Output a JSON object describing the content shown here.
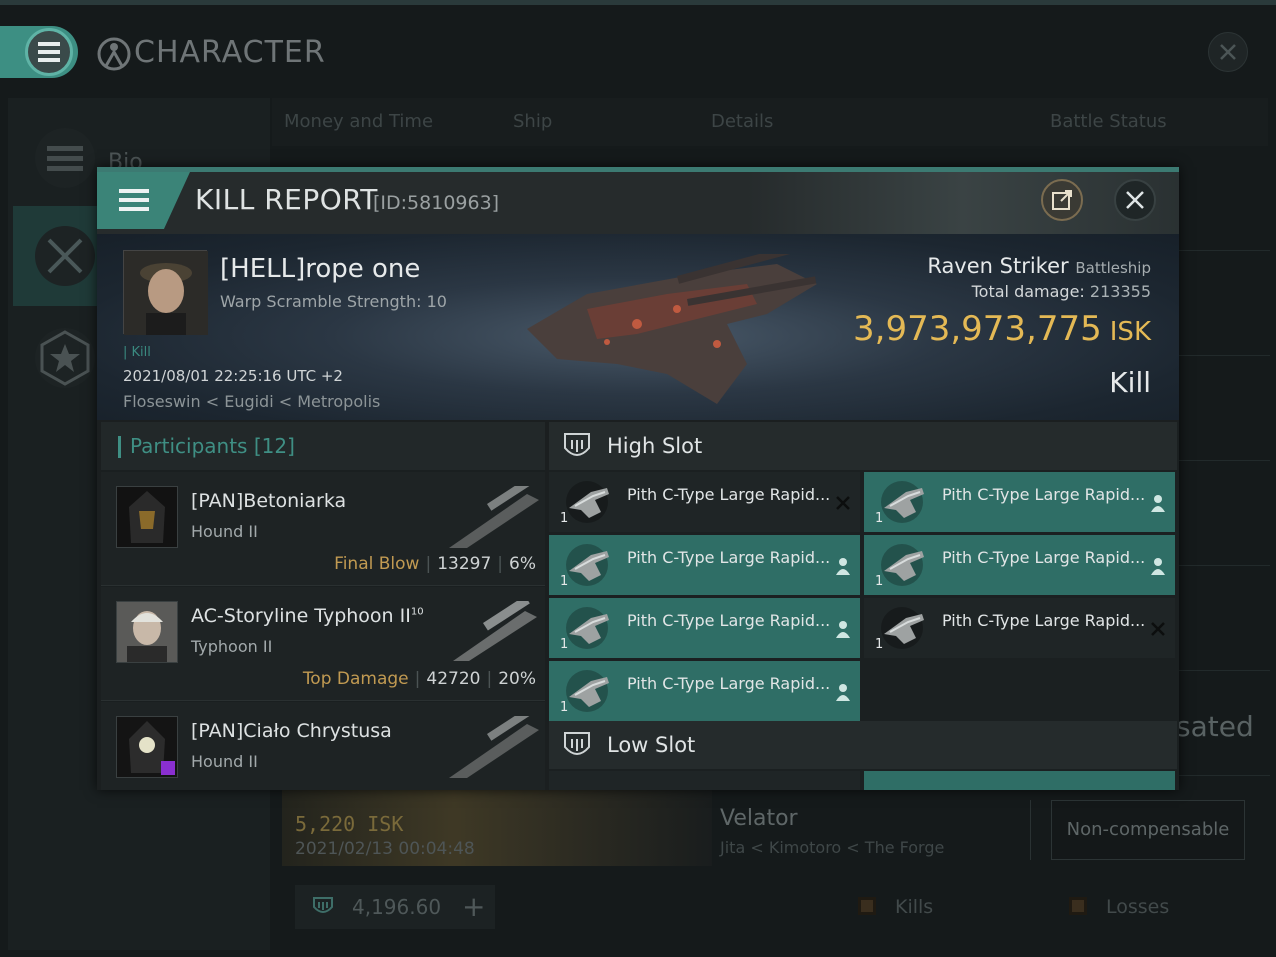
{
  "background_window": {
    "title": "CHARACTER",
    "sidebar": {
      "bio_label": "Bio"
    },
    "tabs": [
      "Money and Time",
      "Ship",
      "Details",
      "Battle Status"
    ],
    "partial_text": "sated",
    "row": {
      "isk": "5,220  ISK",
      "date": "2021/02/13  00:04:48",
      "ship": "Velator",
      "location": "Jita < Kimotoro < The Forge",
      "compensation": "Non-compensable"
    },
    "wallet": {
      "value": "4,196.60",
      "plus": "+"
    },
    "filters": {
      "kills": "Kills",
      "losses": "Losses"
    }
  },
  "kill_report": {
    "title": "KILL REPORT",
    "id": "[ID:5810963]",
    "victim": {
      "name": "[HELL]rope one",
      "warp_scramble": "Warp Scramble Strength: 10",
      "kill_tag": "Kill",
      "datetime": "2021/08/01 22:25:16 UTC +2",
      "location": "Floseswin < Eugidi < Metropolis"
    },
    "ship": {
      "name": "Raven Striker",
      "class": "Battleship",
      "damage_label": "Total damage:",
      "damage_value": "213355",
      "isk_value": "3,973,973,775",
      "isk_unit": "ISK",
      "result": "Kill"
    },
    "participants": {
      "label": "Participants",
      "count": "[12]",
      "items": [
        {
          "name": "[PAN]Betoniarka",
          "ship": "Hound II",
          "tag": "Final Blow",
          "damage": "13297",
          "percent": "6%"
        },
        {
          "name": "AC-Storyline Typhoon II",
          "sup": "10",
          "ship": "Typhoon II",
          "tag": "Top Damage",
          "damage": "42720",
          "percent": "20%"
        },
        {
          "name": "[PAN]Ciało Chrystusa",
          "ship": "Hound II",
          "tag": "",
          "damage": "",
          "percent": ""
        }
      ]
    },
    "high_slot": {
      "label": "High Slot",
      "modules": [
        {
          "name": "Pith C-Type Large Rapid...",
          "qty": "1",
          "status": "destroyed"
        },
        {
          "name": "Pith C-Type Large Rapid...",
          "qty": "1",
          "status": "dropped"
        },
        {
          "name": "Pith C-Type Large Rapid...",
          "qty": "1",
          "status": "dropped"
        },
        {
          "name": "Pith C-Type Large Rapid...",
          "qty": "1",
          "status": "dropped"
        },
        {
          "name": "Pith C-Type Large Rapid...",
          "qty": "1",
          "status": "dropped"
        },
        {
          "name": "Pith C-Type Large Rapid...",
          "qty": "1",
          "status": "destroyed"
        },
        {
          "name": "Pith C-Type Large Rapid...",
          "qty": "1",
          "status": "dropped"
        }
      ]
    },
    "low_slot": {
      "label": "Low Slot"
    }
  },
  "colors": {
    "accent_teal": "#3f8f84",
    "dropped_bg": "#2f6e66",
    "isk_gold": "#e4b955",
    "tag_gold": "#c19a52"
  }
}
